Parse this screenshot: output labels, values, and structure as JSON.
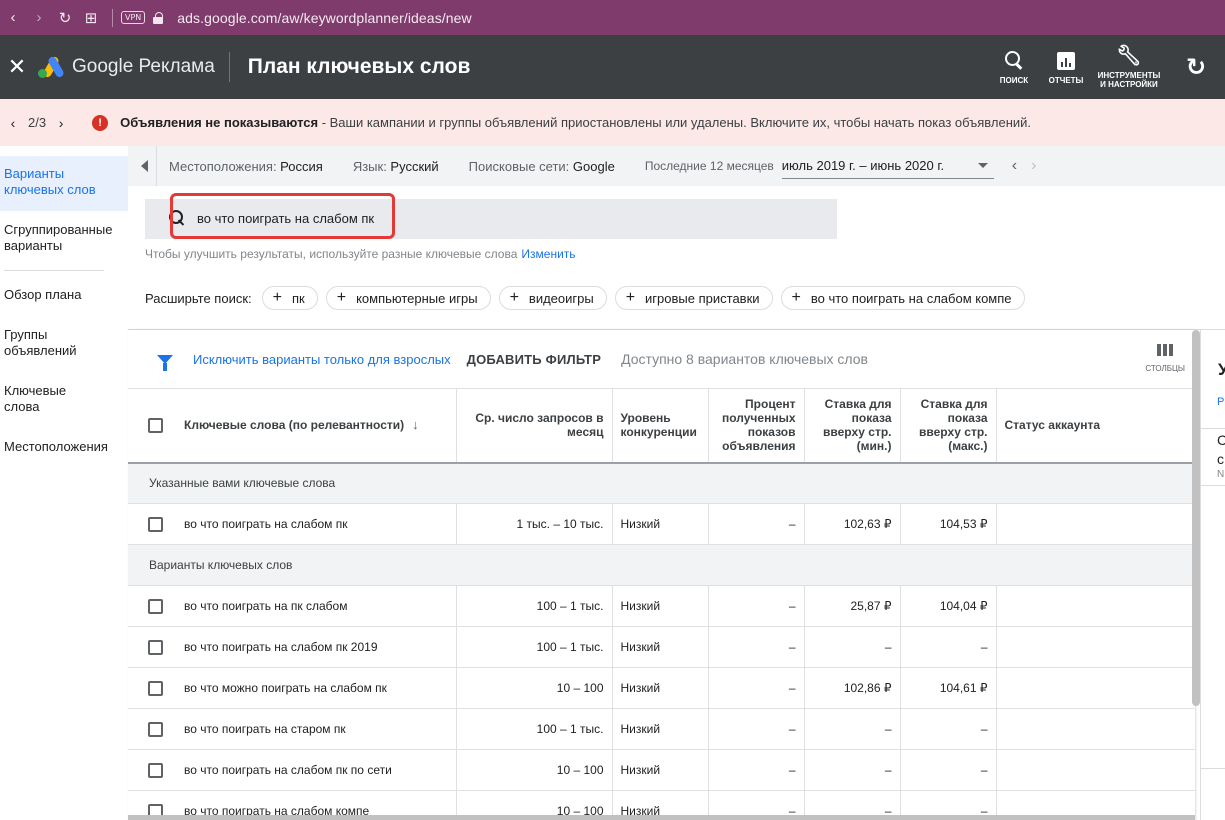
{
  "browser": {
    "vpn": "VPN",
    "url": "ads.google.com/aw/keywordplanner/ideas/new"
  },
  "header": {
    "brand": "Google Реклама",
    "title": "План ключевых слов",
    "actions": {
      "search": "ПОИСК",
      "reports": "ОТЧЕТЫ",
      "tools_line1": "ИНСТРУМЕНТЫ",
      "tools_line2": "И НАСТРОЙКИ"
    }
  },
  "alert": {
    "pager": "2/3",
    "bold": "Объявления не показываются",
    "text": " - Ваши кампании и группы объявлений приостановлены или удалены. Включите их, чтобы начать показ объявлений."
  },
  "nav": {
    "items": [
      {
        "line1": "Варианты",
        "line2": "ключевых слов"
      },
      {
        "line1": "Сгруппированные",
        "line2": "варианты"
      },
      {
        "line1": "Обзор плана",
        "line2": ""
      },
      {
        "line1": "Группы",
        "line2": "объявлений"
      },
      {
        "line1": "Ключевые",
        "line2": "слова"
      },
      {
        "line1": "Местоположения",
        "line2": ""
      }
    ]
  },
  "filters": {
    "location_label": "Местоположения:",
    "location_value": " Россия",
    "language_label": "Язык:",
    "language_value": " Русский",
    "networks_label": "Поисковые сети:",
    "networks_value": " Google",
    "period_label": "Последние 12 месяцев",
    "period_value": "июль 2019 г. – июнь 2020 г."
  },
  "search": {
    "query": "во что поиграть на слабом пк",
    "hint": "Чтобы улучшить результаты, используйте разные ключевые слова",
    "hint_link": "Изменить",
    "expand_label": "Расширьте поиск:",
    "chips": [
      "пк",
      "компьютерные игры",
      "видеоигры",
      "игровые приставки",
      "во что поиграть на слабом компе"
    ]
  },
  "toolbar": {
    "exclude_adult": "Исключить варианты только для взрослых",
    "add_filter": "ДОБАВИТЬ ФИЛЬТР",
    "available": "Доступно 8 вариантов ключевых слов",
    "columns": "СТОЛБЦЫ"
  },
  "table": {
    "headers": {
      "keyword": "Ключевые слова (по релевантности)",
      "searches": "Ср. число запросов в месяц",
      "competition": "Уровень конкуренции",
      "impr_share": "Процент полученных показов объявления",
      "bid_low": "Ставка для показа вверху стр. (мин.)",
      "bid_high": "Ставка для показа вверху стр. (макс.)",
      "status": "Статус аккаунта"
    },
    "section1": "Указанные вами ключевые слова",
    "section2": "Варианты ключевых слов",
    "provided": [
      {
        "kw": "во что поиграть на слабом пк",
        "searches": "1 тыс. – 10 тыс.",
        "comp": "Низкий",
        "share": "–",
        "low": "102,63 ₽",
        "high": "104,53 ₽"
      }
    ],
    "ideas": [
      {
        "kw": "во что поиграть на пк слабом",
        "searches": "100 – 1 тыс.",
        "comp": "Низкий",
        "share": "–",
        "low": "25,87 ₽",
        "high": "104,04 ₽"
      },
      {
        "kw": "во что поиграть на слабом пк 2019",
        "searches": "100 – 1 тыс.",
        "comp": "Низкий",
        "share": "–",
        "low": "–",
        "high": "–"
      },
      {
        "kw": "во что можно поиграть на слабом пк",
        "searches": "10 – 100",
        "comp": "Низкий",
        "share": "–",
        "low": "102,86 ₽",
        "high": "104,61 ₽"
      },
      {
        "kw": "во что поиграть на старом пк",
        "searches": "100 – 1 тыс.",
        "comp": "Низкий",
        "share": "–",
        "low": "–",
        "high": "–"
      },
      {
        "kw": "во что поиграть на слабом пк по сети",
        "searches": "10 – 100",
        "comp": "Низкий",
        "share": "–",
        "low": "–",
        "high": "–"
      },
      {
        "kw": "во что поиграть на слабом компе",
        "searches": "10 – 100",
        "comp": "Низкий",
        "share": "–",
        "low": "–",
        "high": "–"
      }
    ]
  },
  "right_panel": {
    "title": "У",
    "link": "Р",
    "c1": "С",
    "c2": "с",
    "c3": "N"
  }
}
